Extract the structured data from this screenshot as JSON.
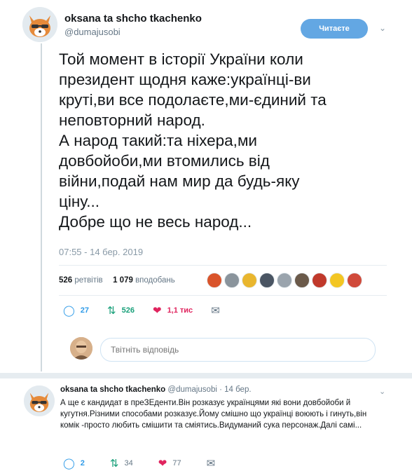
{
  "tweet": {
    "author_name": "oksana ta shcho tkachenko",
    "author_handle": "@dumajusobi",
    "follow_label": "Читаєте",
    "text": "Той момент в історії України коли\nпрезидент щодня каже:українці-ви\nкруті,ви все подолаєте,ми-єдиний та\nнеповторний народ.\nА народ такий:та ніхера,ми\nдовбойоби,ми втомились від\nвійни,подай нам мир да будь-яку\nціну...\nДобре що не весь народ...",
    "timestamp": "07:55 - 14 бер. 2019",
    "retweets_count": "526",
    "retweets_label": "ретвітів",
    "likes_count": "1 079",
    "likes_label": "вподобань",
    "actions": {
      "reply_count": "27",
      "retweet_count": "526",
      "like_count": "1,1 тис"
    }
  },
  "reply_box": {
    "placeholder": "Твітніть відповідь"
  },
  "reply_tweet": {
    "author_name": "oksana ta shcho tkachenko",
    "meta": "@dumajusobi · 14 бер.",
    "text": "А ще є кандидат в преЗЕденти.Він розказує українцями які вони довбойоби й кугутня.Різними способами розказує.Йому смішно що українці воюють і гинуть,він комік -просто любить смішити та сміятись.Видуманий сука персонаж.Далі самі...",
    "actions": {
      "reply_count": "2",
      "retweet_count": "34",
      "like_count": "77"
    }
  },
  "icons": {
    "reply": "reply-icon",
    "retweet": "retweet-icon",
    "like": "heart-icon",
    "dm": "envelope-icon",
    "chevron": "chevron-down-icon"
  },
  "colors": {
    "follow_button": "#63a7e3",
    "reply_blue": "#2f9be8",
    "retweet_green": "#19a07a",
    "like_red": "#e0245e",
    "muted_text": "#657786"
  },
  "liker_avatars": [
    "#d9542b",
    "#8a949c",
    "#e9b62e",
    "#4a5563",
    "#9aa4ad",
    "#6b5a4a",
    "#c0392b",
    "#f3c623",
    "#d04a3a"
  ]
}
